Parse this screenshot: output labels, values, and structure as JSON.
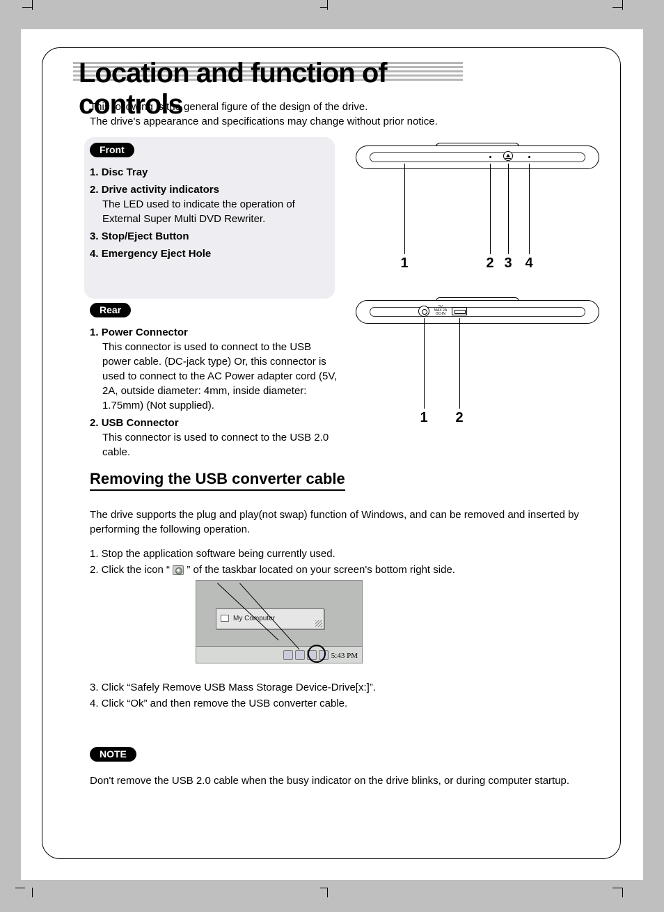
{
  "title": "Location and function of controls",
  "intro_line1": "This following is the general figure of the design of the drive.",
  "intro_line2": "The drive's appearance and specifications may change without prior notice.",
  "labels": {
    "front": "Front",
    "rear": "Rear",
    "note": "NOTE"
  },
  "front_items": [
    {
      "num": "1.",
      "title": "Disc Tray",
      "body": ""
    },
    {
      "num": "2.",
      "title": "Drive activity indicators",
      "body": "The LED used to indicate the operation of External Super Multi DVD Rewriter."
    },
    {
      "num": "3.",
      "title": "Stop/Eject Button",
      "body": ""
    },
    {
      "num": "4.",
      "title": "Emergency Eject Hole",
      "body": ""
    }
  ],
  "rear_items": [
    {
      "num": "1.",
      "title": "Power Connector",
      "body": "This connector is used to connect to the USB power cable. (DC-jack type) Or, this connector is used to connect to the AC Power adapter cord (5V, 2A, outside diameter: 4mm, inside diameter: 1.75mm) (Not supplied)."
    },
    {
      "num": "2.",
      "title": "USB Connector",
      "body": "This connector is used to connect to the USB 2.0 cable."
    }
  ],
  "diagram_front_nums": [
    "1",
    "2",
    "3",
    "4"
  ],
  "diagram_rear_nums": [
    "1",
    "2"
  ],
  "section_heading": "Removing the USB converter cable",
  "para1": "The drive supports the plug and play(not swap) function of Windows, and can be removed and inserted by performing the following operation.",
  "step1": "1. Stop the application software being currently used.",
  "step2_a": "2. Click the icon “ ",
  "step2_b": " ” of the taskbar located on your screen's bottom right side.",
  "step3": "3. Click “Safely Remove USB Mass Storage Device-Drive[x:]”.",
  "step4": "4. Click “Ok” and then remove the USB converter cable.",
  "note_text": "Don't remove the USB 2.0 cable when the busy indicator on the drive blinks, or during computer startup.",
  "screenshot": {
    "window_label": "My Computer",
    "clock": "5:43 PM"
  },
  "rear_port_label_lines": [
    "5V",
    "MAX 2A",
    "DC-IN"
  ]
}
